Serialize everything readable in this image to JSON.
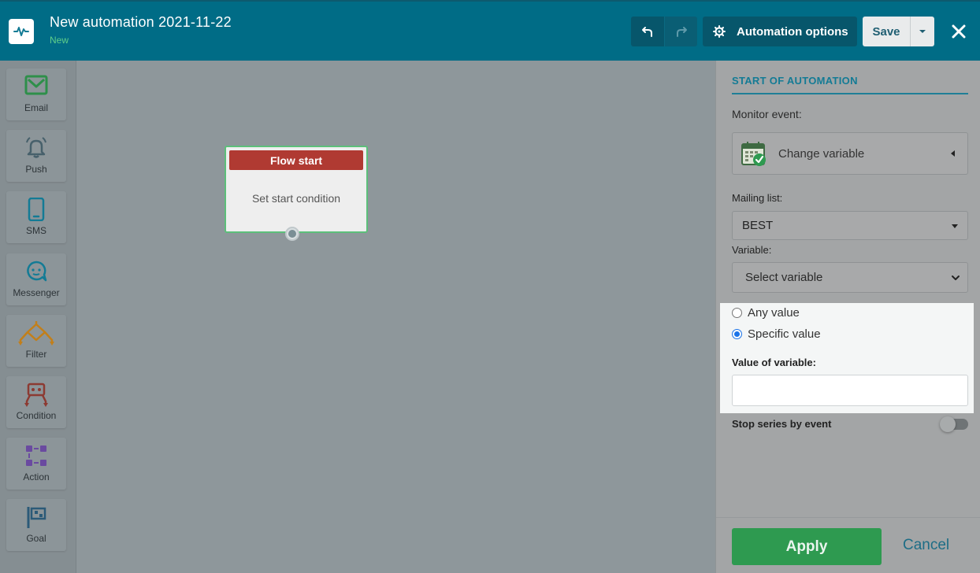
{
  "header": {
    "title": "New automation 2021-11-22",
    "status": "New",
    "options_label": "Automation options",
    "save_label": "Save",
    "icons": [
      "pulse-icon",
      "undo-icon",
      "redo-icon",
      "gear-icon",
      "caret-down-icon",
      "close-icon"
    ]
  },
  "palette": {
    "items": [
      {
        "label": "Email",
        "icon": "email-icon",
        "color": "#2e9a50"
      },
      {
        "label": "Push",
        "icon": "bell-icon",
        "color": "#47606b"
      },
      {
        "label": "SMS",
        "icon": "phone-icon",
        "color": "#137b95"
      },
      {
        "label": "Messenger",
        "icon": "chat-icon",
        "color": "#137b95"
      },
      {
        "label": "Filter",
        "icon": "filter-icon",
        "color": "#b07a1e"
      },
      {
        "label": "Condition",
        "icon": "condition-icon",
        "color": "#8c3a32"
      },
      {
        "label": "Action",
        "icon": "action-icon",
        "color": "#6a4aa0"
      },
      {
        "label": "Goal",
        "icon": "flag-icon",
        "color": "#2b5a78"
      }
    ]
  },
  "canvas": {
    "node": {
      "title": "Flow start",
      "body": "Set start condition"
    }
  },
  "panel": {
    "title": "START OF AUTOMATION",
    "monitor_label": "Monitor event:",
    "monitor_value": "Change variable",
    "mailing_label": "Mailing list:",
    "mailing_value": "BEST",
    "variable_label": "Variable:",
    "variable_placeholder": "Select variable",
    "radio_any": "Any value",
    "radio_specific": "Specific value",
    "selected_radio": "Specific value",
    "value_label": "Value of variable:",
    "value": "",
    "stop_label": "Stop series by event",
    "stop_enabled": false,
    "apply_label": "Apply",
    "cancel_label": "Cancel"
  },
  "colors": {
    "header_bg": "#006c86",
    "accent": "#137b95",
    "apply_green": "#2e9a50",
    "node_header": "#b03a32"
  }
}
